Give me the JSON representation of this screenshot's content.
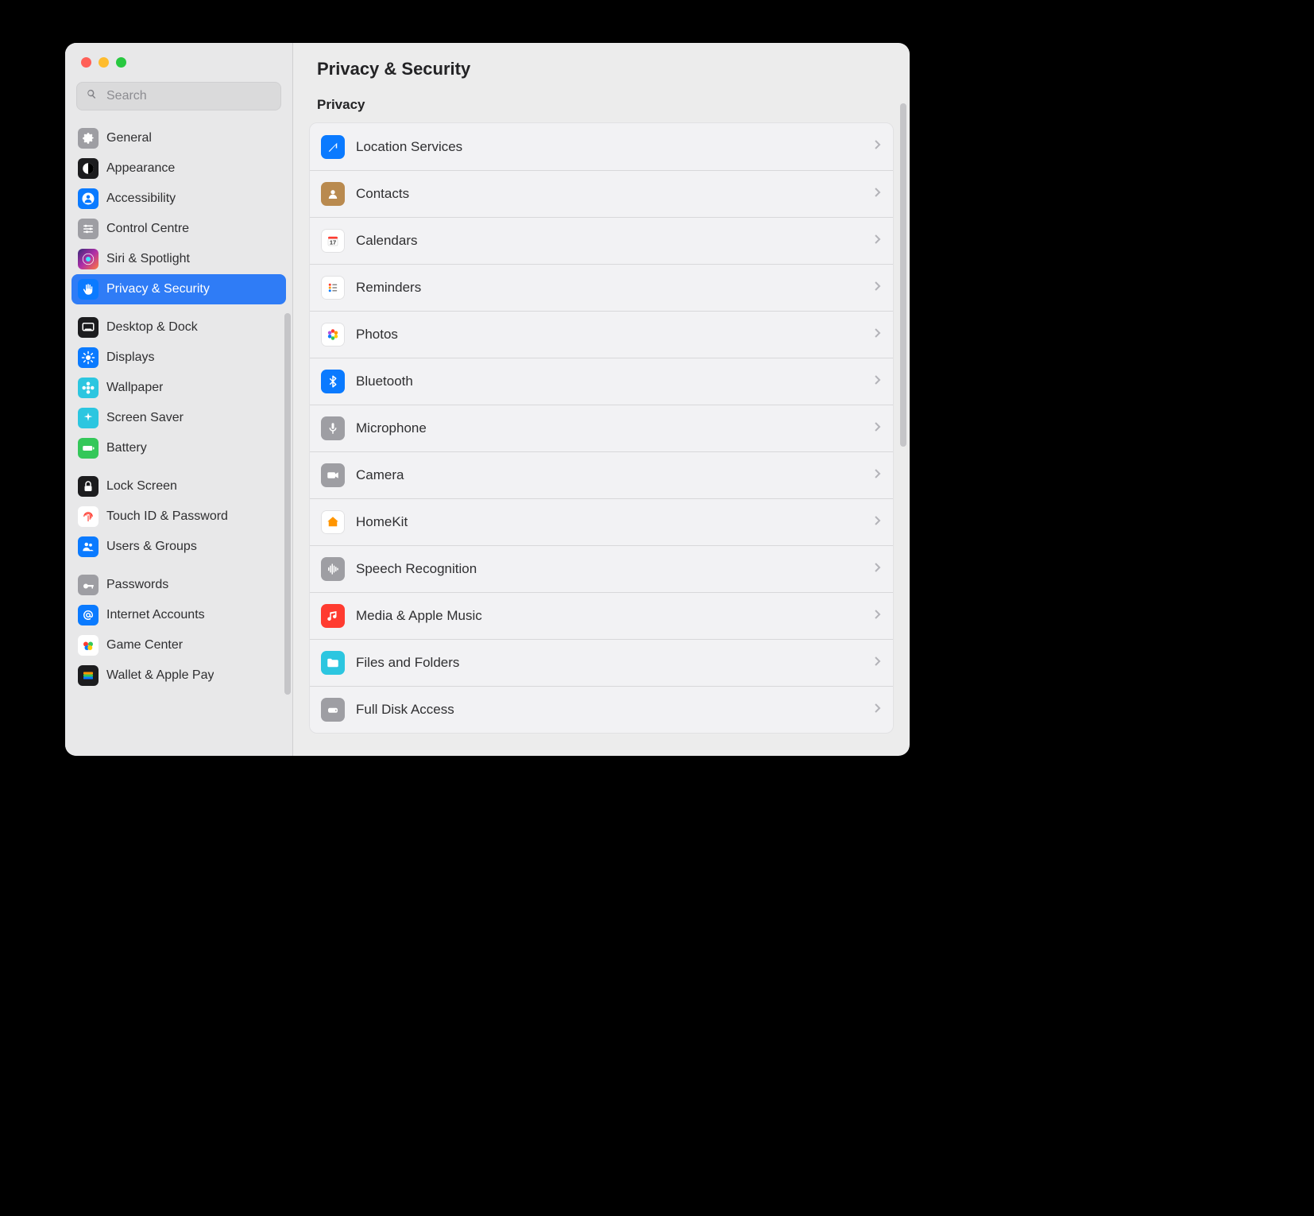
{
  "header": {
    "title": "Privacy & Security"
  },
  "search": {
    "placeholder": "Search"
  },
  "sidebar": {
    "groups": [
      [
        {
          "id": "general",
          "label": "General",
          "bg": "#9e9ea3",
          "glyph": "gear"
        },
        {
          "id": "appearance",
          "label": "Appearance",
          "bg": "#1c1c1e",
          "glyph": "half"
        },
        {
          "id": "accessibility",
          "label": "Accessibility",
          "bg": "#0a7aff",
          "glyph": "person"
        },
        {
          "id": "control-centre",
          "label": "Control Centre",
          "bg": "#9e9ea3",
          "glyph": "sliders"
        },
        {
          "id": "siri-spotlight",
          "label": "Siri & Spotlight",
          "bg": "linear-gradient(135deg,#3b2a7a,#b02ea8,#ff7a3d)",
          "glyph": "siri"
        },
        {
          "id": "privacy-security",
          "label": "Privacy & Security",
          "bg": "#0a7aff",
          "glyph": "hand",
          "selected": true
        }
      ],
      [
        {
          "id": "desktop-dock",
          "label": "Desktop & Dock",
          "bg": "#1c1c1e",
          "glyph": "dock"
        },
        {
          "id": "displays",
          "label": "Displays",
          "bg": "#0a7aff",
          "glyph": "sun"
        },
        {
          "id": "wallpaper",
          "label": "Wallpaper",
          "bg": "#2cc6e0",
          "glyph": "flower"
        },
        {
          "id": "screen-saver",
          "label": "Screen Saver",
          "bg": "#2cc6e0",
          "glyph": "sparkle"
        },
        {
          "id": "battery",
          "label": "Battery",
          "bg": "#34c759",
          "glyph": "battery"
        }
      ],
      [
        {
          "id": "lock-screen",
          "label": "Lock Screen",
          "bg": "#1c1c1e",
          "glyph": "lock"
        },
        {
          "id": "touch-id",
          "label": "Touch ID & Password",
          "bg": "#ffffff",
          "glyph": "fingerprint",
          "fg": "#ff3b30"
        },
        {
          "id": "users-groups",
          "label": "Users & Groups",
          "bg": "#0a7aff",
          "glyph": "people"
        }
      ],
      [
        {
          "id": "passwords",
          "label": "Passwords",
          "bg": "#9e9ea3",
          "glyph": "key"
        },
        {
          "id": "internet-acc",
          "label": "Internet Accounts",
          "bg": "#0a7aff",
          "glyph": "at"
        },
        {
          "id": "game-center",
          "label": "Game Center",
          "bg": "#ffffff",
          "glyph": "gc"
        },
        {
          "id": "wallet",
          "label": "Wallet & Apple Pay",
          "bg": "#1c1c1e",
          "glyph": "wallet"
        }
      ]
    ]
  },
  "content": {
    "section_label": "Privacy",
    "rows": [
      {
        "id": "location",
        "label": "Location Services",
        "bg": "#0a7aff",
        "glyph": "arrow"
      },
      {
        "id": "contacts",
        "label": "Contacts",
        "bg": "#b98a4f",
        "glyph": "contact"
      },
      {
        "id": "calendars",
        "label": "Calendars",
        "bg": "#ffffff",
        "glyph": "calendar",
        "fg": "#ff3b30"
      },
      {
        "id": "reminders",
        "label": "Reminders",
        "bg": "#ffffff",
        "glyph": "list",
        "fg": "#555"
      },
      {
        "id": "photos",
        "label": "Photos",
        "bg": "#ffffff",
        "glyph": "photos"
      },
      {
        "id": "bluetooth",
        "label": "Bluetooth",
        "bg": "#0a7aff",
        "glyph": "bt"
      },
      {
        "id": "microphone",
        "label": "Microphone",
        "bg": "#9e9ea3",
        "glyph": "mic"
      },
      {
        "id": "camera",
        "label": "Camera",
        "bg": "#9e9ea3",
        "glyph": "camera"
      },
      {
        "id": "homekit",
        "label": "HomeKit",
        "bg": "#ffffff",
        "glyph": "home",
        "fg": "#ff9500"
      },
      {
        "id": "speech",
        "label": "Speech Recognition",
        "bg": "#9e9ea3",
        "glyph": "wave"
      },
      {
        "id": "media-music",
        "label": "Media & Apple Music",
        "bg": "#ff3b30",
        "glyph": "music"
      },
      {
        "id": "files",
        "label": "Files and Folders",
        "bg": "#2cc6e0",
        "glyph": "folder"
      },
      {
        "id": "full-disk",
        "label": "Full Disk Access",
        "bg": "#9e9ea3",
        "glyph": "disk"
      }
    ]
  }
}
